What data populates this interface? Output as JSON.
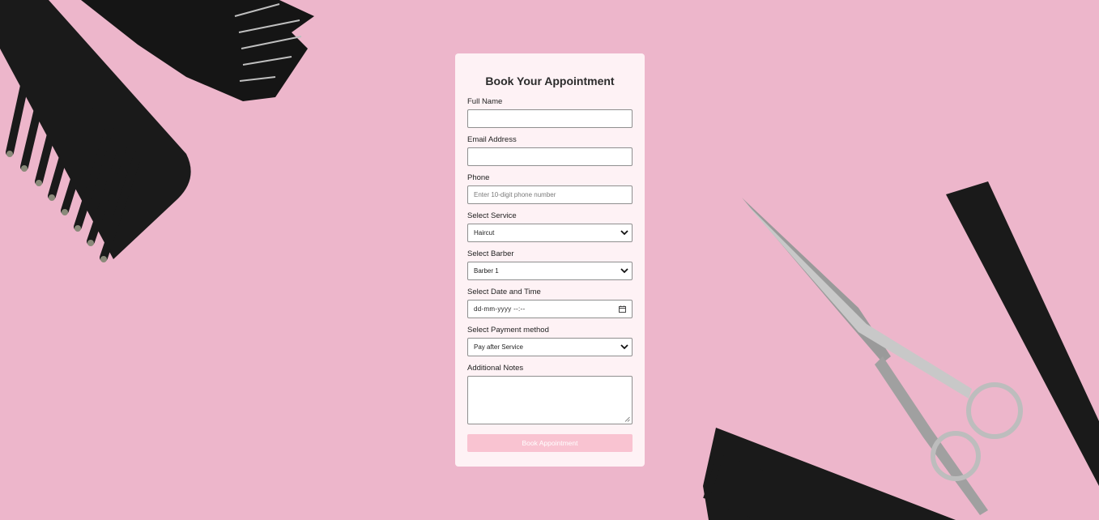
{
  "form": {
    "title": "Book Your Appointment",
    "full_name": {
      "label": "Full Name",
      "value": ""
    },
    "email": {
      "label": "Email Address",
      "value": ""
    },
    "phone": {
      "label": "Phone",
      "placeholder": "Enter 10-digit phone number"
    },
    "service": {
      "label": "Select Service",
      "selected": "Haircut"
    },
    "barber": {
      "label": "Select Barber",
      "selected": "Barber 1"
    },
    "datetime": {
      "label": "Select Date and Time",
      "placeholder": "dd-mm-yyyy  --:--"
    },
    "payment": {
      "label": "Select Payment method",
      "selected": "Pay after Service"
    },
    "notes": {
      "label": "Additional Notes",
      "value": ""
    },
    "submit_label": "Book Appointment"
  },
  "colors": {
    "background": "#edb6cb",
    "button": "#f9c3d1",
    "card": "#fff5f8"
  },
  "icons": {
    "select_arrow": "chevron-down-icon",
    "date_picker": "calendar-icon",
    "resize": "resize-grip-icon"
  }
}
